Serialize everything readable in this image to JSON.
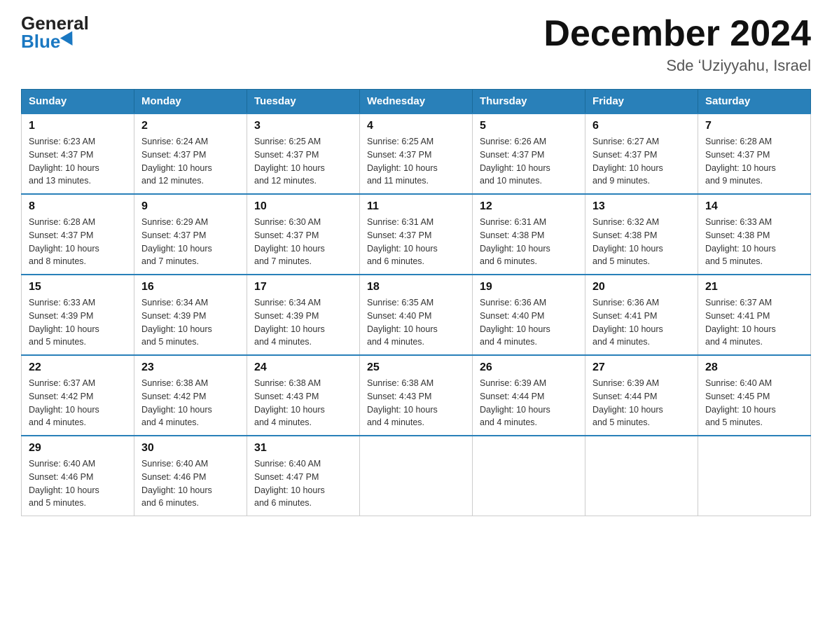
{
  "logo": {
    "general": "General",
    "blue": "Blue"
  },
  "title": "December 2024",
  "location": "Sde ʻUziyyahu, Israel",
  "days_of_week": [
    "Sunday",
    "Monday",
    "Tuesday",
    "Wednesday",
    "Thursday",
    "Friday",
    "Saturday"
  ],
  "weeks": [
    [
      {
        "day": "1",
        "info": "Sunrise: 6:23 AM\nSunset: 4:37 PM\nDaylight: 10 hours\nand 13 minutes."
      },
      {
        "day": "2",
        "info": "Sunrise: 6:24 AM\nSunset: 4:37 PM\nDaylight: 10 hours\nand 12 minutes."
      },
      {
        "day": "3",
        "info": "Sunrise: 6:25 AM\nSunset: 4:37 PM\nDaylight: 10 hours\nand 12 minutes."
      },
      {
        "day": "4",
        "info": "Sunrise: 6:25 AM\nSunset: 4:37 PM\nDaylight: 10 hours\nand 11 minutes."
      },
      {
        "day": "5",
        "info": "Sunrise: 6:26 AM\nSunset: 4:37 PM\nDaylight: 10 hours\nand 10 minutes."
      },
      {
        "day": "6",
        "info": "Sunrise: 6:27 AM\nSunset: 4:37 PM\nDaylight: 10 hours\nand 9 minutes."
      },
      {
        "day": "7",
        "info": "Sunrise: 6:28 AM\nSunset: 4:37 PM\nDaylight: 10 hours\nand 9 minutes."
      }
    ],
    [
      {
        "day": "8",
        "info": "Sunrise: 6:28 AM\nSunset: 4:37 PM\nDaylight: 10 hours\nand 8 minutes."
      },
      {
        "day": "9",
        "info": "Sunrise: 6:29 AM\nSunset: 4:37 PM\nDaylight: 10 hours\nand 7 minutes."
      },
      {
        "day": "10",
        "info": "Sunrise: 6:30 AM\nSunset: 4:37 PM\nDaylight: 10 hours\nand 7 minutes."
      },
      {
        "day": "11",
        "info": "Sunrise: 6:31 AM\nSunset: 4:37 PM\nDaylight: 10 hours\nand 6 minutes."
      },
      {
        "day": "12",
        "info": "Sunrise: 6:31 AM\nSunset: 4:38 PM\nDaylight: 10 hours\nand 6 minutes."
      },
      {
        "day": "13",
        "info": "Sunrise: 6:32 AM\nSunset: 4:38 PM\nDaylight: 10 hours\nand 5 minutes."
      },
      {
        "day": "14",
        "info": "Sunrise: 6:33 AM\nSunset: 4:38 PM\nDaylight: 10 hours\nand 5 minutes."
      }
    ],
    [
      {
        "day": "15",
        "info": "Sunrise: 6:33 AM\nSunset: 4:39 PM\nDaylight: 10 hours\nand 5 minutes."
      },
      {
        "day": "16",
        "info": "Sunrise: 6:34 AM\nSunset: 4:39 PM\nDaylight: 10 hours\nand 5 minutes."
      },
      {
        "day": "17",
        "info": "Sunrise: 6:34 AM\nSunset: 4:39 PM\nDaylight: 10 hours\nand 4 minutes."
      },
      {
        "day": "18",
        "info": "Sunrise: 6:35 AM\nSunset: 4:40 PM\nDaylight: 10 hours\nand 4 minutes."
      },
      {
        "day": "19",
        "info": "Sunrise: 6:36 AM\nSunset: 4:40 PM\nDaylight: 10 hours\nand 4 minutes."
      },
      {
        "day": "20",
        "info": "Sunrise: 6:36 AM\nSunset: 4:41 PM\nDaylight: 10 hours\nand 4 minutes."
      },
      {
        "day": "21",
        "info": "Sunrise: 6:37 AM\nSunset: 4:41 PM\nDaylight: 10 hours\nand 4 minutes."
      }
    ],
    [
      {
        "day": "22",
        "info": "Sunrise: 6:37 AM\nSunset: 4:42 PM\nDaylight: 10 hours\nand 4 minutes."
      },
      {
        "day": "23",
        "info": "Sunrise: 6:38 AM\nSunset: 4:42 PM\nDaylight: 10 hours\nand 4 minutes."
      },
      {
        "day": "24",
        "info": "Sunrise: 6:38 AM\nSunset: 4:43 PM\nDaylight: 10 hours\nand 4 minutes."
      },
      {
        "day": "25",
        "info": "Sunrise: 6:38 AM\nSunset: 4:43 PM\nDaylight: 10 hours\nand 4 minutes."
      },
      {
        "day": "26",
        "info": "Sunrise: 6:39 AM\nSunset: 4:44 PM\nDaylight: 10 hours\nand 4 minutes."
      },
      {
        "day": "27",
        "info": "Sunrise: 6:39 AM\nSunset: 4:44 PM\nDaylight: 10 hours\nand 5 minutes."
      },
      {
        "day": "28",
        "info": "Sunrise: 6:40 AM\nSunset: 4:45 PM\nDaylight: 10 hours\nand 5 minutes."
      }
    ],
    [
      {
        "day": "29",
        "info": "Sunrise: 6:40 AM\nSunset: 4:46 PM\nDaylight: 10 hours\nand 5 minutes."
      },
      {
        "day": "30",
        "info": "Sunrise: 6:40 AM\nSunset: 4:46 PM\nDaylight: 10 hours\nand 6 minutes."
      },
      {
        "day": "31",
        "info": "Sunrise: 6:40 AM\nSunset: 4:47 PM\nDaylight: 10 hours\nand 6 minutes."
      },
      null,
      null,
      null,
      null
    ]
  ]
}
